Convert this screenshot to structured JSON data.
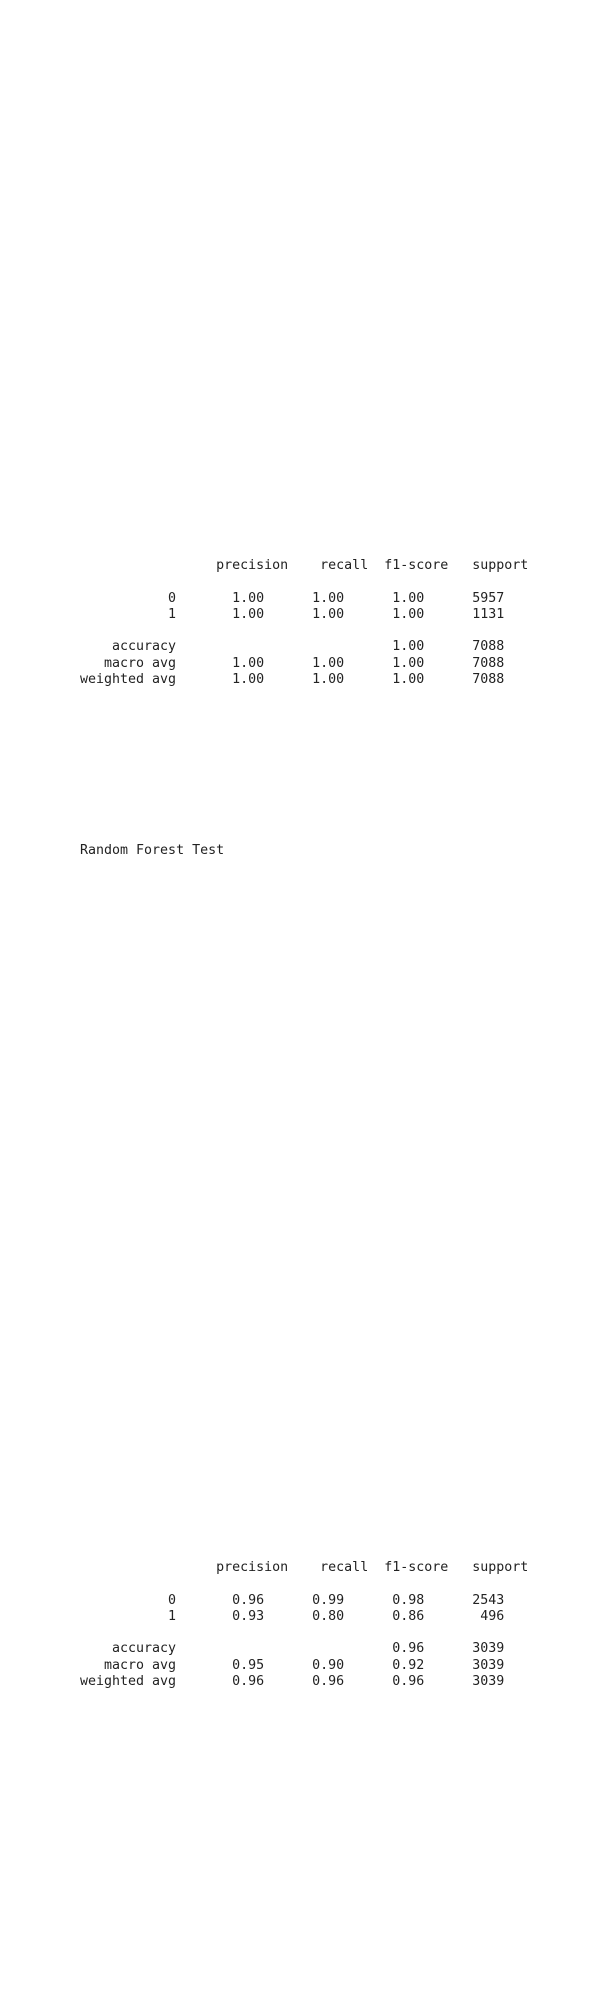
{
  "train_report": {
    "text": "                 precision    recall  f1-score   support\n\n           0       1.00      1.00      1.00      5957\n           1       1.00      1.00      1.00      1131\n\n    accuracy                           1.00      7088\n   macro avg       1.00      1.00      1.00      7088\nweighted avg       1.00      1.00      1.00      7088"
  },
  "test_label": {
    "text": "Random Forest Test"
  },
  "test_report": {
    "text": "                 precision    recall  f1-score   support\n\n           0       0.96      0.99      0.98      2543\n           1       0.93      0.80      0.86       496\n\n    accuracy                           0.96      3039\n   macro avg       0.95      0.90      0.92      3039\nweighted avg       0.96      0.96      0.96      3039"
  }
}
